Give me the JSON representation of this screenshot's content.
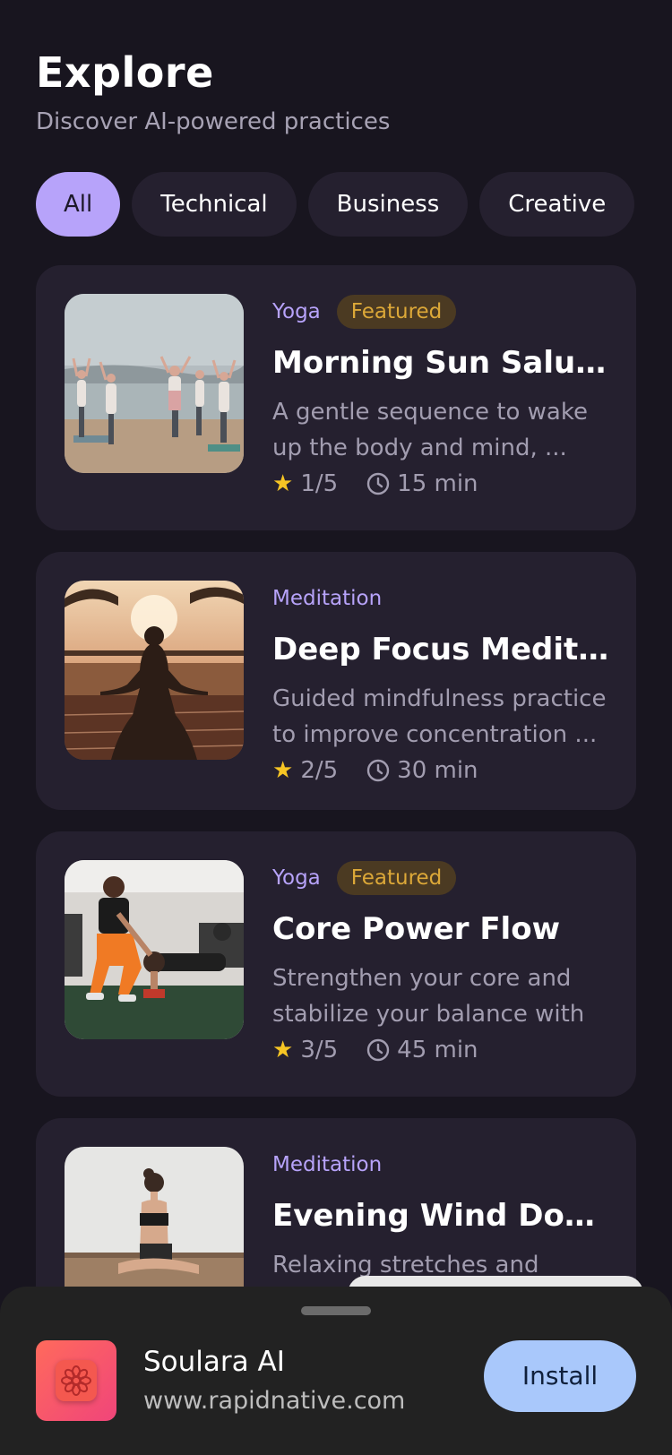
{
  "header": {
    "title": "Explore",
    "subtitle": "Discover AI-powered practices"
  },
  "filters": [
    {
      "label": "All",
      "active": true
    },
    {
      "label": "Technical",
      "active": false
    },
    {
      "label": "Business",
      "active": false
    },
    {
      "label": "Creative",
      "active": false
    }
  ],
  "practices": [
    {
      "category": "Yoga",
      "badge": "Featured",
      "title": "Morning Sun Salut...",
      "description": "A gentle sequence to wake up the body and mind, ...",
      "rating": "1/5",
      "duration": "15 min",
      "image": "beach-group-yoga-photo"
    },
    {
      "category": "Meditation",
      "badge": "",
      "title": "Deep Focus Medita...",
      "description": "Guided mindfulness practice to improve concentration ...",
      "rating": "2/5",
      "duration": "30 min",
      "image": "sunset-meditation-photo"
    },
    {
      "category": "Yoga",
      "badge": "Featured",
      "title": "Core Power Flow",
      "description": "Strengthen your core and stabilize your balance with ...",
      "rating": "3/5",
      "duration": "45 min",
      "image": "gym-training-photo"
    },
    {
      "category": "Meditation",
      "badge": "",
      "title": "Evening Wind Down",
      "description": "Relaxing stretches and breathi...",
      "rating": "",
      "duration": "",
      "image": "seated-stretch-photo"
    }
  ],
  "install_banner": {
    "app_name": "Soulara AI",
    "url": "www.rapidnative.com",
    "button": "Install"
  },
  "colors": {
    "background": "#18151f",
    "card": "#25202f",
    "accent": "#b7a3fa",
    "featured": "#dca838",
    "star": "#f6c524",
    "install": "#a9c8fb"
  }
}
